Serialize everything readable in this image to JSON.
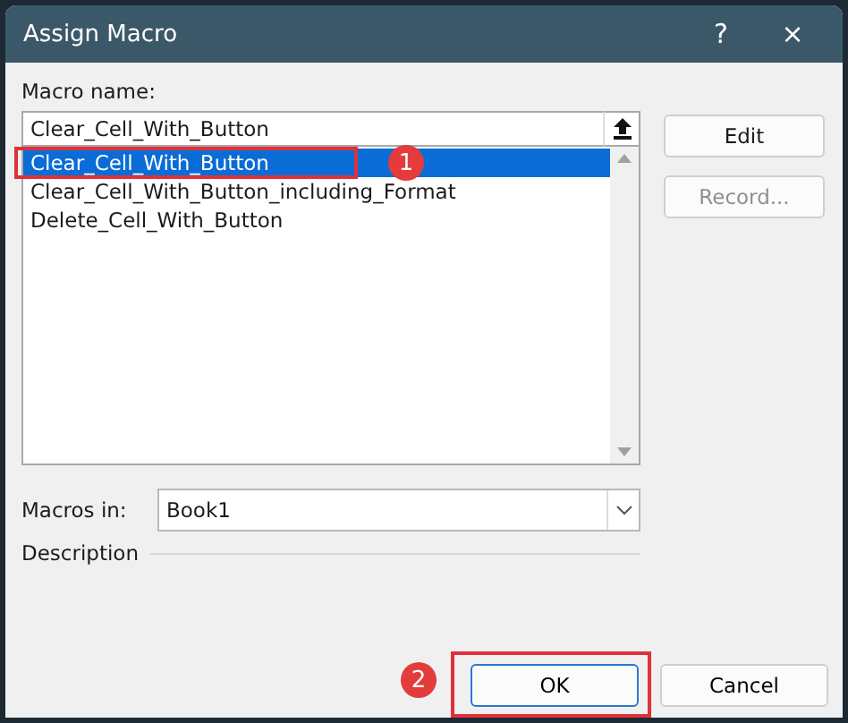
{
  "window": {
    "title": "Assign Macro",
    "help": "?",
    "close": "×"
  },
  "macro_name": {
    "label": "Macro name:",
    "value": "Clear_Cell_With_Button"
  },
  "macros": [
    {
      "name": "Clear_Cell_With_Button",
      "selected": true
    },
    {
      "name": "Clear_Cell_With_Button_including_Format",
      "selected": false
    },
    {
      "name": "Delete_Cell_With_Button",
      "selected": false
    }
  ],
  "side_buttons": [
    {
      "label": "Edit",
      "disabled": false
    },
    {
      "label": "Record...",
      "disabled": true
    }
  ],
  "macros_in": {
    "label": "Macros in:",
    "value": "Book1"
  },
  "description": {
    "label": "Description"
  },
  "buttons": [
    {
      "label": "OK",
      "default": true,
      "callout": "2"
    },
    {
      "label": "Cancel",
      "default": false
    }
  ],
  "list_callout": "1"
}
